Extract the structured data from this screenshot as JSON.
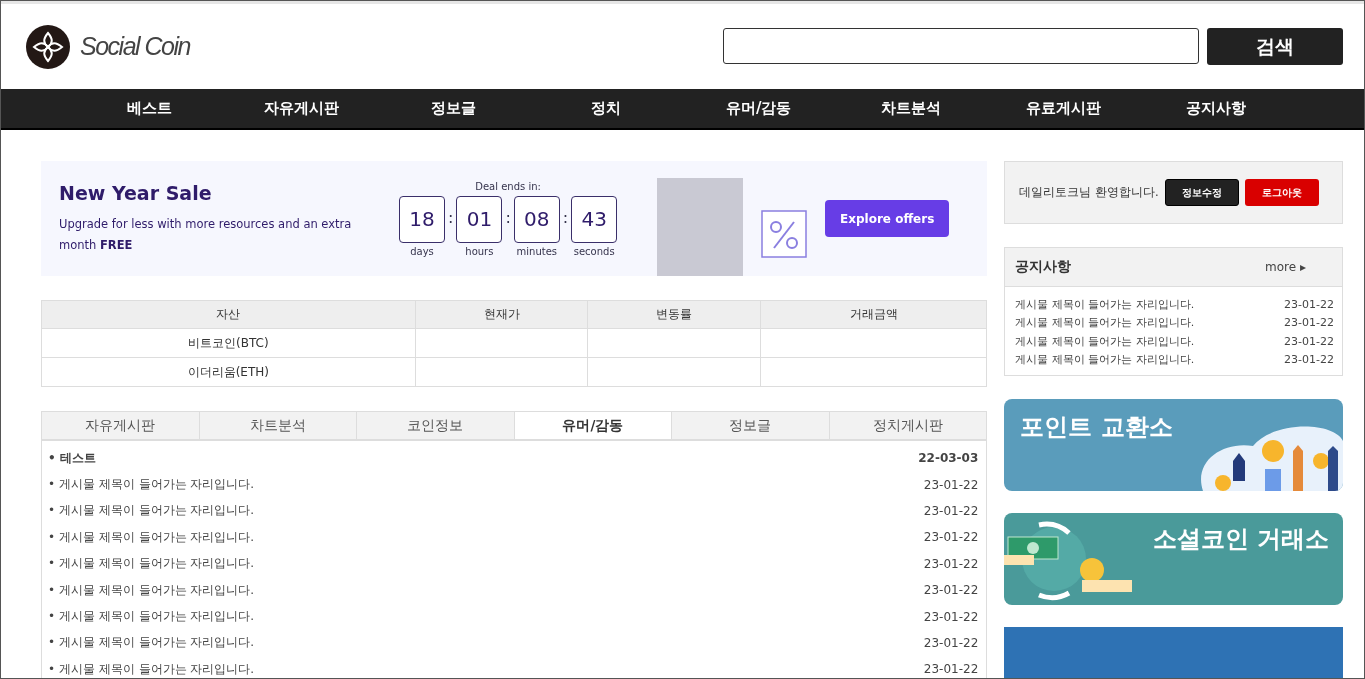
{
  "header": {
    "logo_text": "Social Coin",
    "search_button": "검색"
  },
  "nav": [
    "베스트",
    "자유게시판",
    "정보글",
    "정치",
    "유머/감동",
    "차트분석",
    "유료게시판",
    "공지사항"
  ],
  "promo": {
    "title": "New Year Sale",
    "text": "Upgrade for less with more resources and an extra month **FREE**",
    "deal_label": "Deal ends in:",
    "countdown": [
      {
        "value": "18",
        "unit": "days"
      },
      {
        "separator": ":",
        "value": "01",
        "unit": "hours"
      },
      {
        "separator": ":",
        "value": "08",
        "unit": "minutes"
      },
      {
        "separator": ":",
        "value": "43",
        "unit": "seconds"
      }
    ],
    "button": "Explore offers"
  },
  "asset_table": {
    "columns": [
      "자산",
      "현재가",
      "변동률",
      "거래금액"
    ],
    "rows": [
      [
        "비트코인(BTC)",
        "",
        "",
        ""
      ],
      [
        "이더리움(ETH)",
        "",
        "",
        ""
      ]
    ]
  },
  "board": {
    "tabs": [
      {
        "label": "자유게시판",
        "selected": false
      },
      {
        "label": "차트분석",
        "selected": false
      },
      {
        "label": "코인정보",
        "selected": false
      },
      {
        "label": "유머/감동",
        "selected": true
      },
      {
        "label": "정보글",
        "selected": false
      },
      {
        "label": "정치게시판",
        "selected": false
      }
    ],
    "posts": [
      {
        "title": "• 테스트",
        "date": "22-03-03",
        "bold": true
      },
      {
        "title": "• 게시물 제목이 들어가는 자리입니다.",
        "date": "23-01-22",
        "bold": false
      },
      {
        "title": "• 게시물 제목이 들어가는 자리입니다.",
        "date": "23-01-22",
        "bold": false
      },
      {
        "title": "• 게시물 제목이 들어가는 자리입니다.",
        "date": "23-01-22",
        "bold": false
      },
      {
        "title": "• 게시물 제목이 들어가는 자리입니다.",
        "date": "23-01-22",
        "bold": false
      },
      {
        "title": "• 게시물 제목이 들어가는 자리입니다.",
        "date": "23-01-22",
        "bold": false
      },
      {
        "title": "• 게시물 제목이 들어가는 자리입니다.",
        "date": "23-01-22",
        "bold": false
      },
      {
        "title": "• 게시물 제목이 들어가는 자리입니다.",
        "date": "23-01-22",
        "bold": false
      },
      {
        "title": "• 게시물 제목이 들어가는 자리입니다.",
        "date": "23-01-22",
        "bold": false
      }
    ]
  },
  "user_box": {
    "welcome": "데일리토크님 환영합니다.",
    "edit_button": "정보수정",
    "logout_button": "로그아웃"
  },
  "notice": {
    "title": "공지사항",
    "more": "more ▸",
    "items": [
      {
        "title": "게시물 제목이 들어가는 자리입니다.",
        "date": "23-01-22"
      },
      {
        "title": "게시물 제목이 들어가는 자리입니다.",
        "date": "23-01-22"
      },
      {
        "title": "게시물 제목이 들어가는 자리입니다.",
        "date": "23-01-22"
      },
      {
        "title": "게시물 제목이 들어가는 자리입니다.",
        "date": "23-01-22"
      }
    ]
  },
  "side_banners": [
    {
      "kind": "points",
      "text": "포인트 교환소"
    },
    {
      "kind": "exchange",
      "text": "소셜코인 거래소"
    },
    {
      "kind": "blank"
    }
  ]
}
